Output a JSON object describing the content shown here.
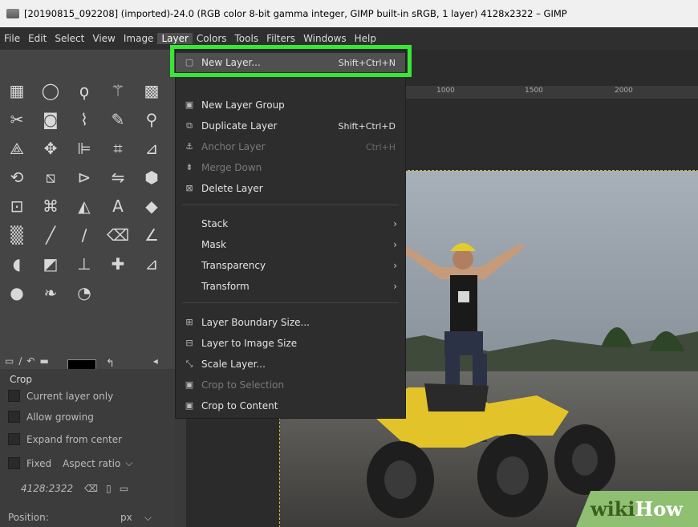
{
  "title": "[20190815_092208] (imported)-24.0 (RGB color 8-bit gamma integer, GIMP built-in sRGB, 1 layer) 4128x2322 – GIMP",
  "menubar": [
    "File",
    "Edit",
    "Select",
    "View",
    "Image",
    "Layer",
    "Colors",
    "Tools",
    "Filters",
    "Windows",
    "Help"
  ],
  "layer_menu": {
    "new_layer": {
      "label": "New Layer...",
      "shortcut": "Shift+Ctrl+N"
    },
    "new_layer_group": "New Layer Group",
    "duplicate_layer": {
      "label": "Duplicate Layer",
      "shortcut": "Shift+Ctrl+D"
    },
    "anchor_layer": {
      "label": "Anchor Layer",
      "shortcut": "Ctrl+H"
    },
    "merge_down": "Merge Down",
    "delete_layer": "Delete Layer",
    "stack": "Stack",
    "mask": "Mask",
    "transparency": "Transparency",
    "transform": "Transform",
    "layer_boundary_size": "Layer Boundary Size...",
    "layer_to_image_size": "Layer to Image Size",
    "scale_layer": "Scale Layer...",
    "crop_to_selection": "Crop to Selection",
    "crop_to_content": "Crop to Content"
  },
  "ruler": [
    "1000",
    "1500",
    "2000"
  ],
  "tool_options": {
    "title": "Crop",
    "current_layer_only": "Current layer only",
    "allow_growing": "Allow growing",
    "expand_from_center": "Expand from center",
    "fixed": "Fixed",
    "aspect_ratio": "Aspect ratio",
    "ratio_value": "4128:2322",
    "position_label": "Position:",
    "position_unit": "px"
  },
  "watermark": {
    "wiki": "wiki",
    "how": "How"
  },
  "colors": {
    "highlight": "#39e636",
    "menu_bg": "#2d2d2d",
    "canvas_bg": "#2b2b2b",
    "foreground": "#000000",
    "background": "#ffffff"
  }
}
